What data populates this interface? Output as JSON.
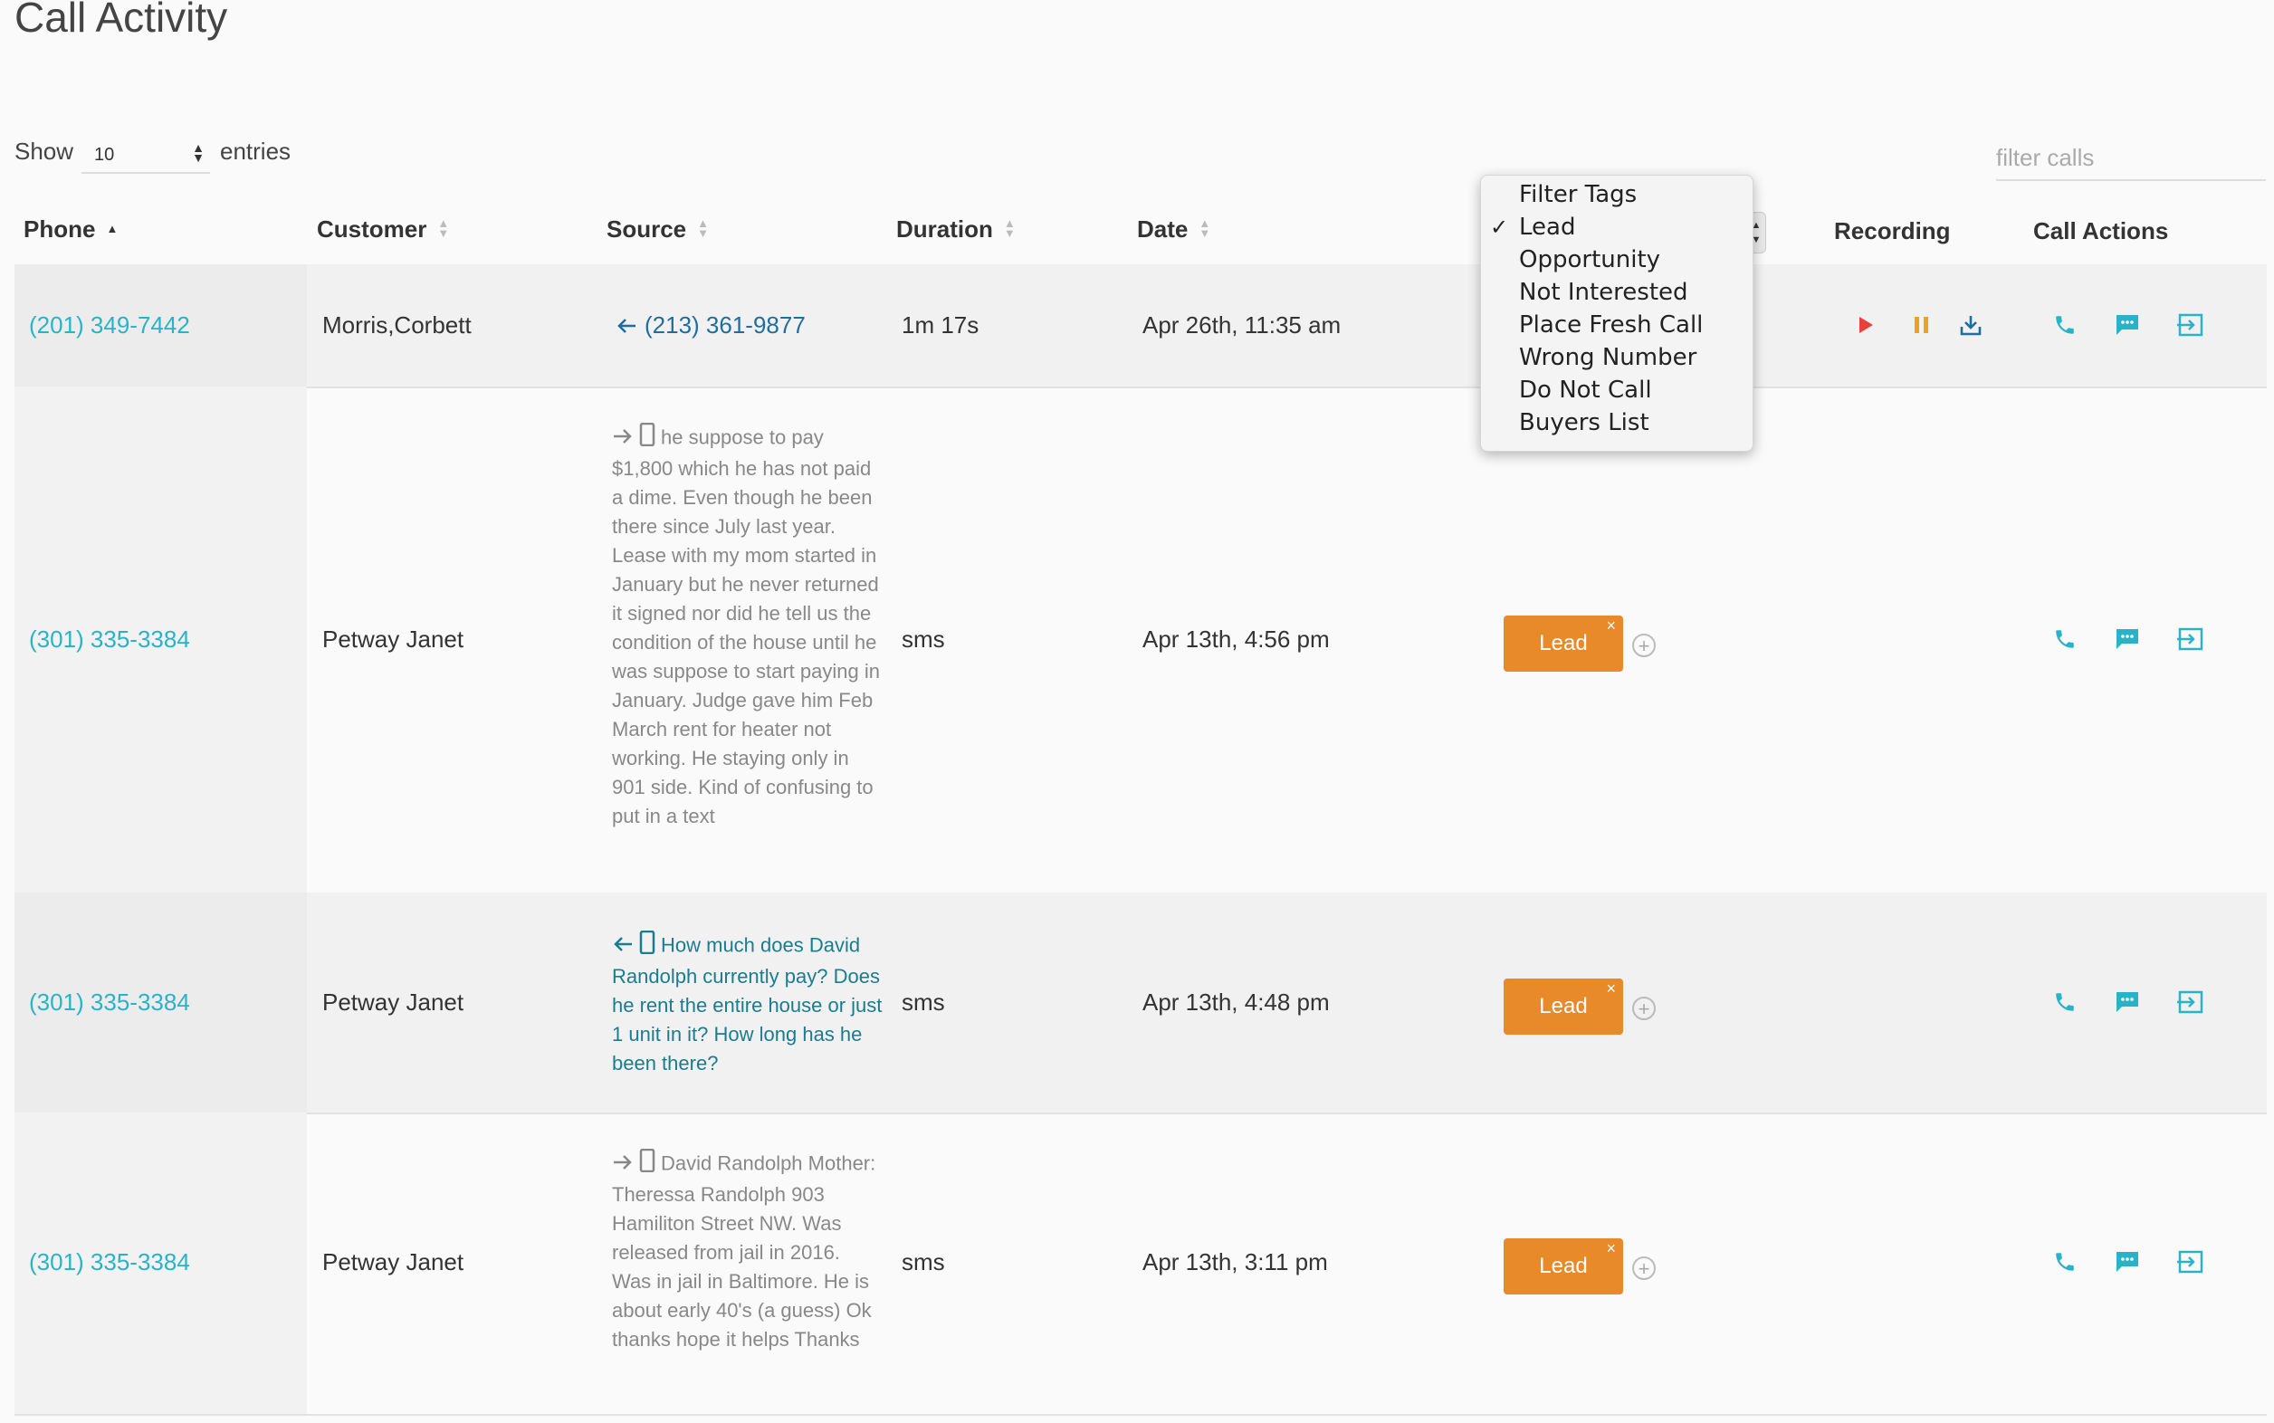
{
  "page": {
    "title": "Call Activity"
  },
  "controls": {
    "show_label": "Show",
    "entries_value": "10",
    "entries_label": "entries",
    "filter_placeholder": "filter calls"
  },
  "columns": {
    "phone": "Phone",
    "customer": "Customer",
    "source": "Source",
    "duration": "Duration",
    "date": "Date",
    "recording": "Recording",
    "call_actions": "Call Actions"
  },
  "tags_menu": {
    "options": [
      "Filter Tags",
      "Lead",
      "Opportunity",
      "Not Interested",
      "Place Fresh Call",
      "Wrong Number",
      "Do Not Call",
      "Buyers List"
    ],
    "selected": "Lead"
  },
  "rows": [
    {
      "phone": "(201) 349-7442",
      "customer": "Morris,Corbett",
      "source": "(213) 361-9877",
      "duration": "1m 17s",
      "date": "Apr 26th, 11:35 am"
    },
    {
      "phone": "(301) 335-3384",
      "customer": "Petway Janet",
      "source": "he suppose to pay $1,800 which he has not paid a dime. Even though he been there since July last year. Lease with my mom started in January but he never returned it signed nor did he tell us the condition of the house until he was suppose to start paying in January. Judge gave him Feb March rent for heater not working. He staying only in 901 side. Kind of confusing to put in a text",
      "duration": "sms",
      "date": "Apr 13th, 4:56 pm",
      "tag": "Lead"
    },
    {
      "phone": "(301) 335-3384",
      "customer": "Petway Janet",
      "source": "How much does David Randolph currently pay? Does he rent the entire house or just 1 unit in it? How long has he been there?",
      "duration": "sms",
      "date": "Apr 13th, 4:48 pm",
      "tag": "Lead"
    },
    {
      "phone": "(301) 335-3384",
      "customer": "Petway Janet",
      "source": "David Randolph Mother: Theressa Randolph 903 Hamiliton Street NW. Was released from jail in 2016. Was in jail in Baltimore. He is about early 40's (a guess) Ok thanks hope it helps Thanks",
      "duration": "sms",
      "date": "Apr 13th, 3:11 pm",
      "tag": "Lead"
    }
  ],
  "icons": {
    "play": "play-icon",
    "pause": "pause-icon",
    "download": "download-icon",
    "call": "phone-icon",
    "message": "chat-icon",
    "transfer": "transfer-icon"
  },
  "colors": {
    "accent": "#29b3c9",
    "tag": "#e8892a",
    "play": "#e8403a",
    "pause": "#f0a020"
  }
}
